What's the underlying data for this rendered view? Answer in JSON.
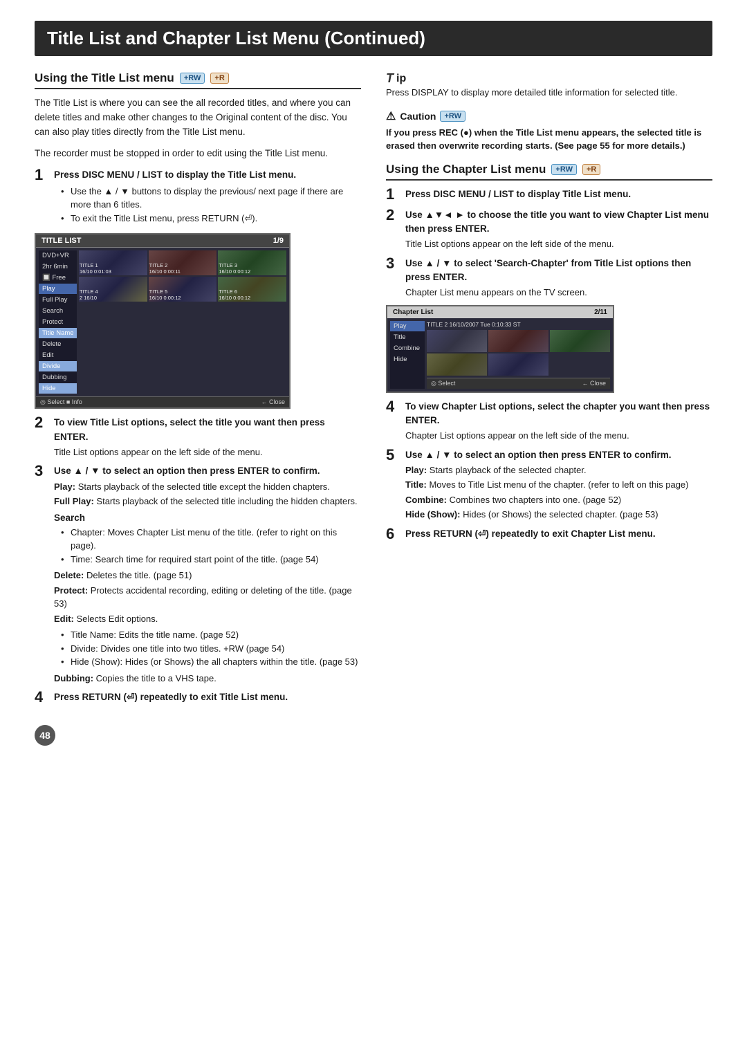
{
  "page": {
    "title": "Title List and Chapter List Menu (Continued)",
    "page_number": "48"
  },
  "left_section": {
    "header": "Using the Title List menu",
    "badges": [
      "+RW",
      "+R"
    ],
    "intro_text": "The Title List is where you can see the all recorded titles, and where you can delete titles and make other changes to the Original content of the disc. You can also play titles directly from the Title List menu.",
    "intro_text2": "The recorder must be stopped in order to edit using the Title List menu.",
    "steps": [
      {
        "num": "1",
        "title": "Press DISC MENU / LIST to display the Title List menu.",
        "bullets": [
          "Use the ▲ / ▼ buttons to display the previous/ next page if there are more than 6 titles.",
          "To exit the Title List menu, press RETURN (⏎)."
        ]
      },
      {
        "num": "2",
        "title": "To view Title List options, select the title you want then press ENTER.",
        "detail": "Title List options appear on the left side of the menu."
      },
      {
        "num": "3",
        "title": "Use ▲ / ▼ to select an option then press ENTER to confirm.",
        "options": [
          {
            "label": "Play:",
            "text": "Starts playback of the selected title except the hidden chapters."
          },
          {
            "label": "Full Play:",
            "text": "Starts playback of the selected title including the hidden chapters."
          }
        ],
        "search_label": "Search",
        "search_bullets": [
          "Chapter: Moves Chapter List menu of the title. (refer to right on this page).",
          "Time: Search time for required start point of the title. (page 54)"
        ],
        "more_options": [
          {
            "label": "Delete:",
            "text": "Deletes the title. (page 51)"
          },
          {
            "label": "Protect:",
            "text": "Protects accidental recording, editing or deleting of the title. (page 53)"
          },
          {
            "label": "Edit:",
            "text": "Selects Edit options."
          }
        ],
        "edit_bullets": [
          "Title Name: Edits the title name. (page 52)",
          "Divide: Divides one title into two titles. +RW (page 54)",
          "Hide (Show): Hides (or Shows) the all chapters within the title. (page 53)"
        ],
        "dubbing": {
          "label": "Dubbing:",
          "text": "Copies the title to a VHS tape."
        }
      },
      {
        "num": "4",
        "title": "Press RETURN (⏎) repeatedly to exit Title List menu."
      }
    ],
    "screen": {
      "header_left": "TITLE LIST",
      "header_right": "1/9",
      "info_row": "DVD+VR",
      "info_row2": "2hour 6min  Free",
      "sidebar_items": [
        "Play",
        "Full Play",
        "Search",
        "Protect",
        "Delete",
        "Edit",
        "Dubbing"
      ],
      "sidebar_highlight": "Title Name",
      "sidebar_highlight2": "Divide",
      "sidebar_highlight3": "Hide",
      "thumbs": [
        {
          "label": "TITLE 1",
          "time1": "16/10",
          "time2": "0:01:03"
        },
        {
          "label": "TITLE 2",
          "time1": "16/10",
          "time2": "0:00:11"
        },
        {
          "label": "TITLE 3",
          "time1": "16/10",
          "time2": "0:00:12"
        },
        {
          "label": "TITLE 4",
          "time1": "2",
          "time2": "16/10"
        },
        {
          "label": "TITLE 5",
          "time1": "16/10",
          "time2": "0:00:12"
        },
        {
          "label": "TITLE 6",
          "time1": "16/10",
          "time2": "0:00:12"
        }
      ],
      "footer_left": "◎ Select  ■ Info",
      "footer_right": "← Close"
    }
  },
  "right_section": {
    "tip": {
      "title": "ip",
      "text": "Press DISPLAY to display more detailed title information for selected title."
    },
    "caution": {
      "title": "Caution",
      "badge": "+RW",
      "text": "If you press REC (●) when the Title List menu appears, the selected title is erased then overwrite recording starts. (See page 55 for more details.)"
    },
    "header": "Using the Chapter List menu",
    "badges": [
      "+RW",
      "+R"
    ],
    "steps": [
      {
        "num": "1",
        "title": "Press DISC MENU / LIST to display Title List menu."
      },
      {
        "num": "2",
        "title": "Use ▲▼◄ ► to choose the title you want to view Chapter List menu then press ENTER.",
        "detail": "Title List options appear on the left side of the menu."
      },
      {
        "num": "3",
        "title": "Use ▲ / ▼ to select 'Search-Chapter' from Title List options then press ENTER.",
        "detail": "Chapter List menu appears on the TV screen."
      },
      {
        "num": "4",
        "title": "To view Chapter List options, select the chapter you want then press ENTER.",
        "detail": "Chapter List options appear on the left side of the menu."
      },
      {
        "num": "5",
        "title": "Use ▲ / ▼ to select an option then press ENTER to confirm.",
        "options": [
          {
            "label": "Play:",
            "text": "Starts playback of the selected chapter."
          },
          {
            "label": "Title:",
            "text": "Moves to Title List menu of the chapter. (refer to left on this page)"
          },
          {
            "label": "Combine:",
            "text": "Combines two chapters into one. (page 52)"
          },
          {
            "label": "Hide (Show):",
            "text": "Hides (or Shows) the selected chapter. (page 53)"
          }
        ]
      },
      {
        "num": "6",
        "title": "Press RETURN (⏎) repeatedly to exit Chapter List menu."
      }
    ],
    "chapter_screen": {
      "header_left": "Chapter List",
      "header_right": "2/11",
      "title_info": "TITLE 2",
      "title_date": "16/10/2007 Tue  0:10:33  ST",
      "sidebar_items": [
        "Play",
        "Title",
        "Combine",
        "Hide"
      ],
      "footer_left": "◎ Select",
      "footer_right": "← Close"
    }
  }
}
